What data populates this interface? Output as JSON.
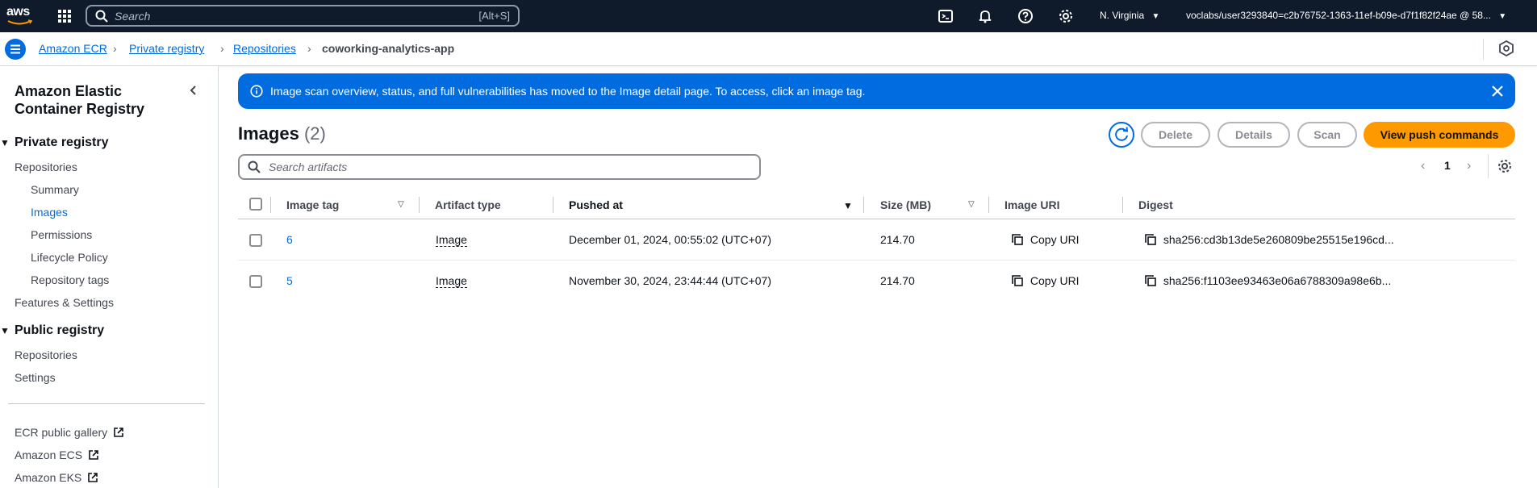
{
  "topnav": {
    "logo_text": "aws",
    "search_placeholder": "Search",
    "search_shortcut": "[Alt+S]",
    "region": "N. Virginia",
    "account": "voclabs/user3293840=c2b76752-1363-11ef-b09e-d7f1f82f24ae @ 58..."
  },
  "breadcrumb": {
    "items": [
      "Amazon ECR",
      "Private registry",
      "Repositories"
    ],
    "current": "coworking-analytics-app"
  },
  "sidenav": {
    "title": "Amazon Elastic Container Registry",
    "private_header": "Private registry",
    "private_items": [
      "Repositories",
      "Summary",
      "Images",
      "Permissions",
      "Lifecycle Policy",
      "Repository tags",
      "Features & Settings"
    ],
    "public_header": "Public registry",
    "public_items": [
      "Repositories",
      "Settings"
    ],
    "external_links": [
      "ECR public gallery",
      "Amazon ECS",
      "Amazon EKS"
    ],
    "active_item": "Images"
  },
  "flash": {
    "message": "Image scan overview, status, and full vulnerabilities has moved to the Image detail page. To access, click an image tag."
  },
  "images": {
    "heading": "Images",
    "count": "(2)",
    "buttons": {
      "delete": "Delete",
      "details": "Details",
      "scan": "Scan",
      "push": "View push commands"
    },
    "search_placeholder": "Search artifacts",
    "page": "1",
    "columns": [
      "Image tag",
      "Artifact type",
      "Pushed at",
      "Size (MB)",
      "Image URI",
      "Digest"
    ],
    "rows": [
      {
        "tag": "6",
        "type": "Image",
        "pushed": "December 01, 2024, 00:55:02 (UTC+07)",
        "size": "214.70",
        "uri": "Copy URI",
        "digest": "sha256:cd3b13de5e260809be25515e196cd..."
      },
      {
        "tag": "5",
        "type": "Image",
        "pushed": "November 30, 2024, 23:44:44 (UTC+07)",
        "size": "214.70",
        "uri": "Copy URI",
        "digest": "sha256:f1103ee93463e06a6788309a98e6b..."
      }
    ]
  },
  "colors": {
    "nav_bg": "#0f1b2a",
    "link": "#006ce0",
    "primary_button": "#ff9900",
    "flash_bg": "#006ce0"
  }
}
